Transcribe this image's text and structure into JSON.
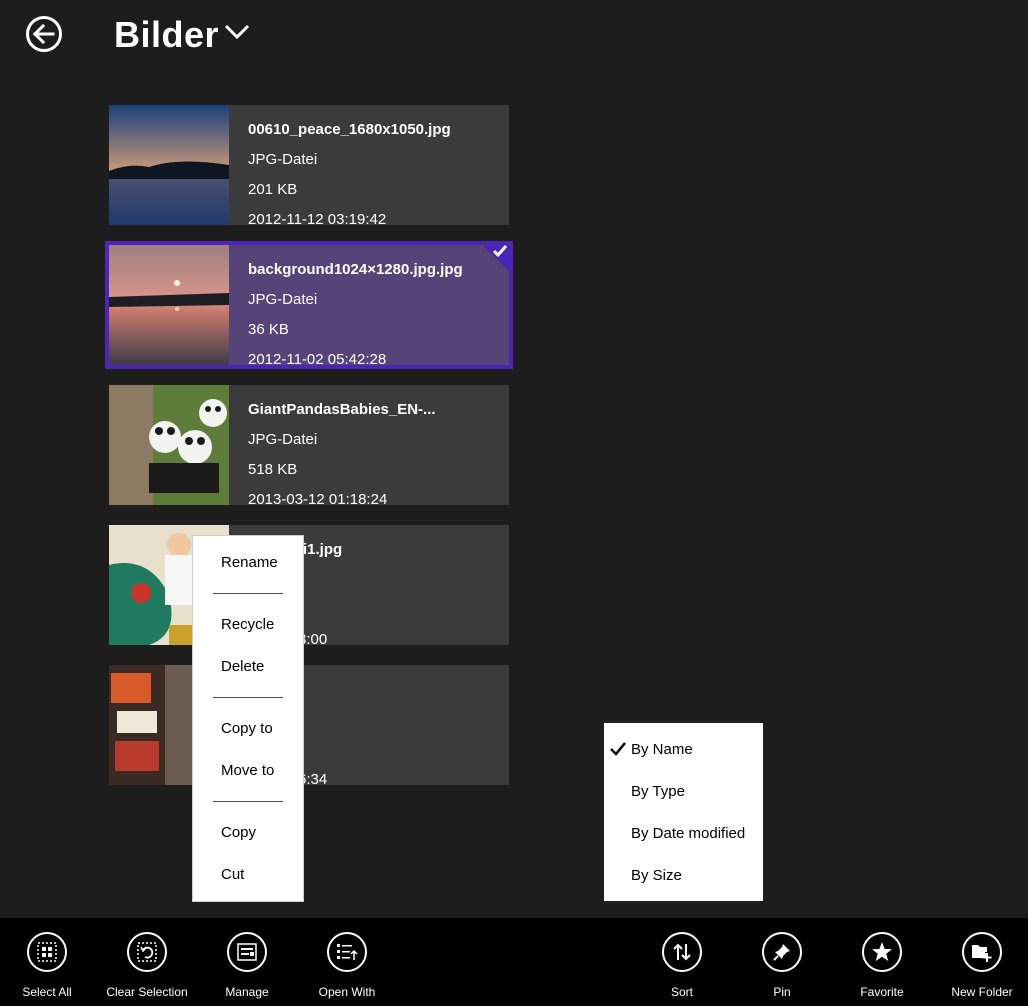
{
  "header": {
    "title": "Bilder"
  },
  "files": [
    {
      "name": "00610_peace_1680x1050.jpg",
      "type": "JPG-Datei",
      "size": "201 KB",
      "date": "2012-11-12 03:19:42"
    },
    {
      "name": "background1024×1280.jpg.jpg",
      "type": "JPG-Datei",
      "size": "36 KB",
      "date": "2012-11-02 05:42:28",
      "selected": true
    },
    {
      "name": "GiantPandasBabies_EN-...",
      "type": "JPG-Datei",
      "size": "518 KB",
      "date": "2013-03-12 01:18:24"
    },
    {
      "name": "llo-mutti1.jpg",
      "type": "ei",
      "size": "",
      "date": "17 02:33:00"
    },
    {
      "name": "",
      "type": "ei",
      "size": "",
      "date": "17 03:06:34"
    }
  ],
  "context_menu": {
    "rename": "Rename",
    "recycle": "Recycle",
    "delete": "Delete",
    "copy_to": "Copy to",
    "move_to": "Move to",
    "copy": "Copy",
    "cut": "Cut"
  },
  "sort_menu": {
    "by_name": "By Name",
    "by_type": "By Type",
    "by_date": "By Date modified",
    "by_size": "By Size",
    "checked": "By Name"
  },
  "appbar": {
    "select_all": "Select All",
    "clear_selection": "Clear Selection",
    "manage": "Manage",
    "open_with": "Open With",
    "sort": "Sort",
    "pin": "Pin",
    "favorite": "Favorite",
    "new_folder": "New Folder"
  },
  "colors": {
    "background": "#1d1d1d",
    "tile": "#3b3b3b",
    "selected_tile": "#564478",
    "accent": "#4a25b8",
    "appbar": "#000000"
  }
}
